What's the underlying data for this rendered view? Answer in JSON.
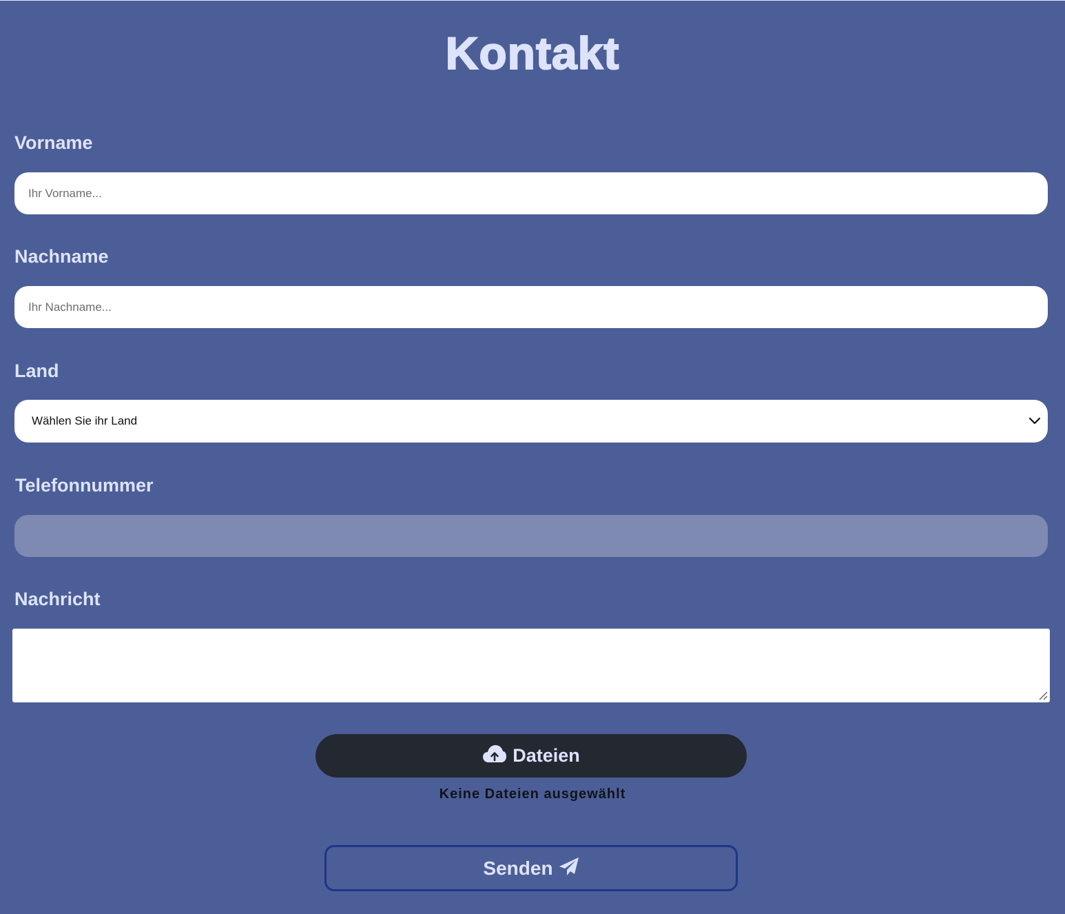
{
  "page": {
    "title": "Kontakt",
    "background_color": "#4c5e97",
    "text_color": "#dde3fb"
  },
  "form": {
    "firstname": {
      "label": "Vorname",
      "placeholder": "Ihr Vorname...",
      "value": ""
    },
    "lastname": {
      "label": "Nachname",
      "placeholder": "Ihr Nachname...",
      "value": ""
    },
    "country": {
      "label": "Land",
      "selected": "Wählen Sie ihr Land",
      "icon": "chevron-down-icon"
    },
    "phone": {
      "label": "Telefonnummer",
      "value": "",
      "disabled": true
    },
    "message": {
      "label": "Nachricht",
      "value": ""
    },
    "files": {
      "button_label": "Dateien",
      "icon": "cloud-upload-icon",
      "status": "Keine Dateien ausgewählt",
      "button_color": "#232831"
    },
    "submit": {
      "label": "Senden",
      "icon": "paper-plane-icon",
      "border_color": "#1f3587"
    }
  }
}
